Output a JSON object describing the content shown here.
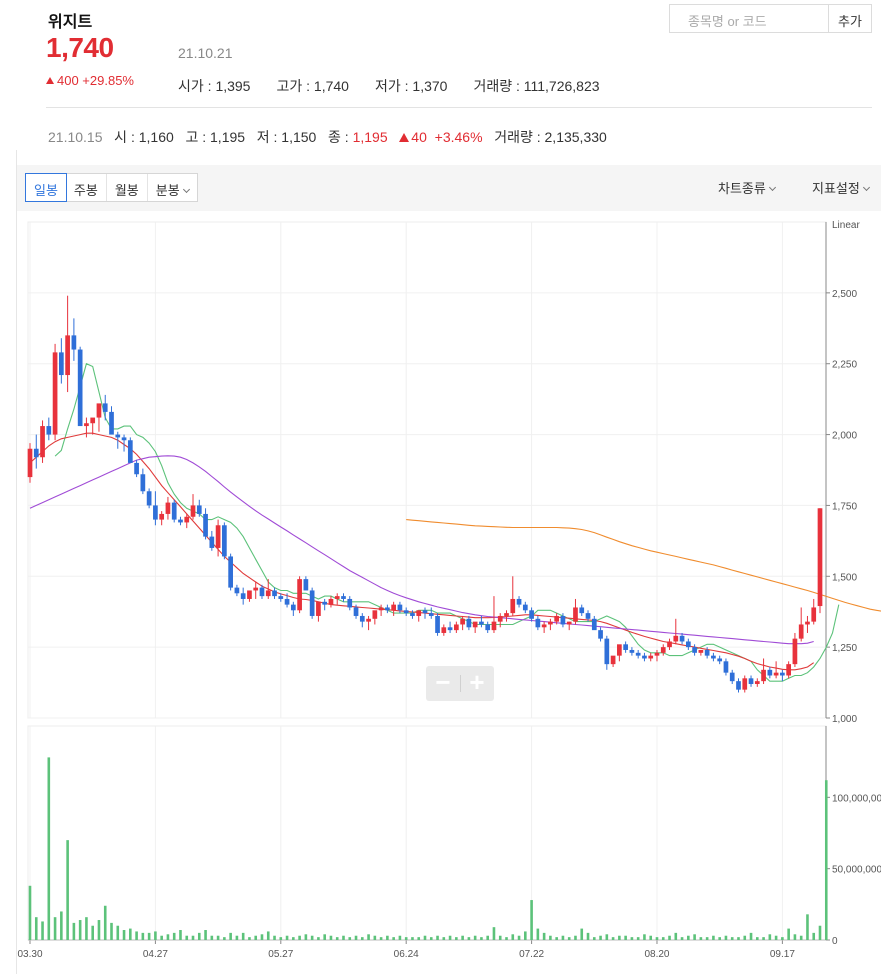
{
  "header": {
    "name": "위지트",
    "price": "1,740",
    "date": "21.10.21",
    "change": "400 +29.85%",
    "stats": [
      {
        "label": "시가",
        "value": "1,395"
      },
      {
        "label": "고가",
        "value": "1,740"
      },
      {
        "label": "저가",
        "value": "1,370"
      },
      {
        "label": "거래량",
        "value": "111,726,823"
      }
    ]
  },
  "search": {
    "placeholder": "종목명 or 코드",
    "add_label": "추가"
  },
  "previous": {
    "date": "21.10.15",
    "open_label": "시",
    "open": "1,160",
    "high_label": "고",
    "high": "1,195",
    "low_label": "저",
    "low": "1,150",
    "close_label": "종",
    "close": "1,195",
    "change": "40",
    "pct": "+3.46%",
    "volume_label": "거래량",
    "volume": "2,135,330"
  },
  "toolbar": {
    "tabs": [
      "일봉",
      "주봉",
      "월봉",
      "분봉"
    ],
    "active": "일봉",
    "chart_type_label": "차트종류",
    "indicator_label": "지표설정"
  },
  "colors": {
    "up": "#e8323c",
    "down": "#2f6fd8",
    "ma5": "#5cc27a",
    "ma20": "#e03a3a",
    "ma60": "#a04bd6",
    "ma120": "#f08c2e",
    "volume": "#5cc27a"
  },
  "chart_data": {
    "type": "candlestick",
    "scale_label": "Linear",
    "price_ylim": [
      1000,
      2750
    ],
    "price_ticks": [
      1000,
      1250,
      1500,
      1750,
      2000,
      2250,
      2500
    ],
    "volume_ylim": [
      0,
      150000000
    ],
    "volume_ticks": [
      "0",
      "50,000,000",
      "100,000,000"
    ],
    "x_ticks": [
      "03.30",
      "04.27",
      "05.27",
      "06.24",
      "07.22",
      "08.20",
      "09.17"
    ],
    "x_tick_index": [
      0,
      20,
      40,
      60,
      80,
      100,
      120
    ],
    "candles": [
      [
        1850,
        1970,
        1830,
        1950
      ],
      [
        1950,
        2000,
        1880,
        1920
      ],
      [
        1920,
        2050,
        1900,
        2030
      ],
      [
        2030,
        2060,
        1980,
        2000
      ],
      [
        2000,
        2320,
        1980,
        2290
      ],
      [
        2290,
        2340,
        2180,
        2210
      ],
      [
        2210,
        2490,
        2150,
        2350
      ],
      [
        2350,
        2410,
        2260,
        2300
      ],
      [
        2300,
        2310,
        2060,
        2030
      ],
      [
        2030,
        2060,
        1990,
        2040
      ],
      [
        2040,
        2050,
        2000,
        2060
      ],
      [
        2060,
        2080,
        2010,
        2110
      ],
      [
        2110,
        2140,
        2050,
        2080
      ],
      [
        2080,
        2100,
        2010,
        2000
      ],
      [
        2000,
        2010,
        1950,
        1990
      ],
      [
        1990,
        2000,
        1940,
        1980
      ],
      [
        1980,
        1990,
        1900,
        1900
      ],
      [
        1900,
        1910,
        1850,
        1860
      ],
      [
        1860,
        1880,
        1790,
        1800
      ],
      [
        1800,
        1810,
        1740,
        1750
      ],
      [
        1750,
        1800,
        1680,
        1700
      ],
      [
        1700,
        1730,
        1680,
        1720
      ],
      [
        1720,
        1780,
        1700,
        1760
      ],
      [
        1760,
        1770,
        1690,
        1700
      ],
      [
        1700,
        1710,
        1680,
        1690
      ],
      [
        1690,
        1720,
        1670,
        1710
      ],
      [
        1710,
        1790,
        1700,
        1750
      ],
      [
        1750,
        1770,
        1710,
        1720
      ],
      [
        1720,
        1740,
        1630,
        1640
      ],
      [
        1640,
        1660,
        1590,
        1600
      ],
      [
        1600,
        1700,
        1570,
        1680
      ],
      [
        1680,
        1690,
        1560,
        1570
      ],
      [
        1570,
        1580,
        1450,
        1460
      ],
      [
        1460,
        1470,
        1430,
        1440
      ],
      [
        1440,
        1460,
        1400,
        1420
      ],
      [
        1420,
        1440,
        1410,
        1450
      ],
      [
        1450,
        1480,
        1420,
        1460
      ],
      [
        1460,
        1470,
        1420,
        1430
      ],
      [
        1430,
        1490,
        1420,
        1450
      ],
      [
        1450,
        1460,
        1420,
        1430
      ],
      [
        1430,
        1440,
        1410,
        1420
      ],
      [
        1420,
        1440,
        1390,
        1400
      ],
      [
        1400,
        1410,
        1360,
        1380
      ],
      [
        1380,
        1500,
        1370,
        1490
      ],
      [
        1490,
        1500,
        1460,
        1450
      ],
      [
        1450,
        1460,
        1350,
        1360
      ],
      [
        1360,
        1370,
        1340,
        1410
      ],
      [
        1410,
        1420,
        1380,
        1400
      ],
      [
        1400,
        1430,
        1390,
        1420
      ],
      [
        1420,
        1440,
        1400,
        1430
      ],
      [
        1430,
        1440,
        1410,
        1420
      ],
      [
        1420,
        1430,
        1380,
        1390
      ],
      [
        1390,
        1400,
        1350,
        1360
      ],
      [
        1360,
        1370,
        1320,
        1340
      ],
      [
        1340,
        1360,
        1310,
        1350
      ],
      [
        1350,
        1370,
        1330,
        1380
      ],
      [
        1380,
        1400,
        1360,
        1390
      ],
      [
        1390,
        1400,
        1370,
        1380
      ],
      [
        1380,
        1410,
        1360,
        1400
      ],
      [
        1400,
        1410,
        1370,
        1380
      ],
      [
        1380,
        1390,
        1360,
        1370
      ],
      [
        1370,
        1380,
        1350,
        1360
      ],
      [
        1360,
        1370,
        1340,
        1380
      ],
      [
        1380,
        1390,
        1350,
        1370
      ],
      [
        1370,
        1390,
        1350,
        1360
      ],
      [
        1360,
        1370,
        1290,
        1300
      ],
      [
        1300,
        1330,
        1290,
        1320
      ],
      [
        1320,
        1340,
        1300,
        1310
      ],
      [
        1310,
        1340,
        1300,
        1330
      ],
      [
        1330,
        1360,
        1310,
        1350
      ],
      [
        1350,
        1360,
        1310,
        1320
      ],
      [
        1320,
        1330,
        1300,
        1340
      ],
      [
        1340,
        1360,
        1320,
        1330
      ],
      [
        1330,
        1340,
        1300,
        1310
      ],
      [
        1310,
        1430,
        1300,
        1340
      ],
      [
        1340,
        1370,
        1320,
        1360
      ],
      [
        1360,
        1380,
        1340,
        1370
      ],
      [
        1370,
        1500,
        1360,
        1420
      ],
      [
        1420,
        1430,
        1390,
        1400
      ],
      [
        1400,
        1410,
        1370,
        1380
      ],
      [
        1380,
        1390,
        1340,
        1350
      ],
      [
        1350,
        1360,
        1310,
        1320
      ],
      [
        1320,
        1340,
        1300,
        1330
      ],
      [
        1330,
        1350,
        1310,
        1340
      ],
      [
        1340,
        1370,
        1330,
        1360
      ],
      [
        1360,
        1370,
        1320,
        1330
      ],
      [
        1330,
        1340,
        1310,
        1340
      ],
      [
        1340,
        1420,
        1330,
        1390
      ],
      [
        1390,
        1400,
        1360,
        1370
      ],
      [
        1370,
        1380,
        1340,
        1350
      ],
      [
        1350,
        1360,
        1320,
        1310
      ],
      [
        1310,
        1320,
        1270,
        1280
      ],
      [
        1280,
        1290,
        1170,
        1190
      ],
      [
        1190,
        1210,
        1180,
        1220
      ],
      [
        1220,
        1230,
        1200,
        1260
      ],
      [
        1260,
        1270,
        1230,
        1240
      ],
      [
        1240,
        1250,
        1220,
        1230
      ],
      [
        1230,
        1240,
        1210,
        1220
      ],
      [
        1220,
        1230,
        1200,
        1210
      ],
      [
        1210,
        1230,
        1200,
        1220
      ],
      [
        1220,
        1240,
        1200,
        1230
      ],
      [
        1230,
        1260,
        1220,
        1250
      ],
      [
        1250,
        1280,
        1240,
        1270
      ],
      [
        1270,
        1350,
        1260,
        1290
      ],
      [
        1290,
        1300,
        1260,
        1270
      ],
      [
        1270,
        1280,
        1240,
        1250
      ],
      [
        1250,
        1260,
        1220,
        1230
      ],
      [
        1230,
        1240,
        1220,
        1240
      ],
      [
        1240,
        1250,
        1210,
        1220
      ],
      [
        1220,
        1230,
        1200,
        1210
      ],
      [
        1210,
        1220,
        1190,
        1200
      ],
      [
        1200,
        1210,
        1150,
        1160
      ],
      [
        1160,
        1170,
        1120,
        1130
      ],
      [
        1130,
        1140,
        1090,
        1100
      ],
      [
        1100,
        1150,
        1090,
        1140
      ],
      [
        1140,
        1150,
        1110,
        1120
      ],
      [
        1120,
        1140,
        1110,
        1130
      ],
      [
        1130,
        1210,
        1120,
        1170
      ],
      [
        1170,
        1180,
        1140,
        1150
      ],
      [
        1150,
        1200,
        1140,
        1160
      ],
      [
        1160,
        1170,
        1130,
        1150
      ],
      [
        1150,
        1200,
        1140,
        1190
      ],
      [
        1190,
        1300,
        1180,
        1280
      ],
      [
        1280,
        1390,
        1270,
        1330
      ],
      [
        1330,
        1360,
        1300,
        1340
      ],
      [
        1340,
        1420,
        1330,
        1390
      ],
      [
        1395,
        1740,
        1370,
        1740
      ]
    ],
    "ma": [
      {
        "period": 5,
        "color": "#5cc27a",
        "start": 4,
        "values": [
          1924,
          1944,
          2020,
          2090,
          2170,
          2250,
          2240,
          2150,
          2060,
          2020,
          2020,
          2030,
          2030,
          2000,
          1990,
          1970,
          1940,
          1890,
          1830,
          1790,
          1760,
          1740,
          1730,
          1720,
          1700,
          1700,
          1710,
          1700,
          1690,
          1670,
          1640,
          1600,
          1560,
          1520,
          1480,
          1460,
          1450,
          1450,
          1440,
          1440,
          1440,
          1430,
          1420,
          1430,
          1430,
          1420,
          1410,
          1410,
          1410,
          1410,
          1410,
          1400,
          1390,
          1380,
          1370,
          1370,
          1370,
          1370,
          1380,
          1380,
          1380,
          1370,
          1370,
          1370,
          1360,
          1350,
          1340,
          1330,
          1330,
          1330,
          1330,
          1330,
          1330,
          1330,
          1340,
          1350,
          1360,
          1380,
          1380,
          1380,
          1370,
          1360,
          1350,
          1340,
          1340,
          1340,
          1340,
          1350,
          1360,
          1350,
          1340,
          1320,
          1290,
          1260,
          1240,
          1230,
          1230,
          1230,
          1220,
          1220,
          1220,
          1230,
          1240,
          1250,
          1260,
          1260,
          1250,
          1240,
          1230,
          1220,
          1210,
          1200,
          1170,
          1150,
          1130,
          1130,
          1130,
          1140,
          1150,
          1150,
          1160,
          1180,
          1210,
          1250,
          1300,
          1400
        ]
      },
      {
        "period": 20,
        "color": "#e03a3a",
        "start": 0,
        "values": [
          1900,
          1920,
          1940,
          1960,
          1975,
          1985,
          1990,
          1995,
          2000,
          2005,
          2005,
          2000,
          1995,
          1990,
          1980,
          1965,
          1950,
          1930,
          1905,
          1880,
          1850,
          1820,
          1795,
          1770,
          1745,
          1720,
          1695,
          1670,
          1645,
          1620,
          1595,
          1570,
          1550,
          1530,
          1510,
          1495,
          1480,
          1465,
          1455,
          1445,
          1438,
          1432,
          1425,
          1420,
          1418,
          1415,
          1410,
          1405,
          1400,
          1398,
          1396,
          1394,
          1392,
          1390,
          1388,
          1386,
          1384,
          1382,
          1380,
          1378,
          1376,
          1374,
          1372,
          1370,
          1368,
          1366,
          1364,
          1362,
          1360,
          1358,
          1356,
          1354,
          1354,
          1354,
          1355,
          1356,
          1358,
          1360,
          1362,
          1364,
          1364,
          1362,
          1360,
          1358,
          1356,
          1354,
          1352,
          1350,
          1348,
          1346,
          1344,
          1340,
          1334,
          1326,
          1318,
          1310,
          1302,
          1295,
          1288,
          1282,
          1276,
          1270,
          1266,
          1262,
          1258,
          1254,
          1250,
          1246,
          1242,
          1238,
          1234,
          1230,
          1224,
          1218,
          1210,
          1200,
          1192,
          1186,
          1180,
          1176,
          1172,
          1170,
          1170,
          1174,
          1180,
          1195
        ]
      },
      {
        "period": 60,
        "color": "#a04bd6",
        "start": 0,
        "values": [
          1740,
          1750,
          1760,
          1770,
          1780,
          1790,
          1800,
          1810,
          1820,
          1830,
          1840,
          1850,
          1860,
          1870,
          1880,
          1890,
          1900,
          1910,
          1915,
          1920,
          1922,
          1924,
          1925,
          1924,
          1920,
          1912,
          1900,
          1886,
          1870,
          1852,
          1834,
          1815,
          1797,
          1780,
          1763,
          1747,
          1731,
          1716,
          1702,
          1688,
          1674,
          1660,
          1646,
          1632,
          1618,
          1604,
          1590,
          1576,
          1562,
          1548,
          1534,
          1520,
          1508,
          1496,
          1484,
          1472,
          1460,
          1450,
          1440,
          1432,
          1424,
          1417,
          1410,
          1404,
          1398,
          1392,
          1387,
          1382,
          1377,
          1372,
          1368,
          1364,
          1361,
          1358,
          1356,
          1354,
          1352,
          1350,
          1348,
          1346,
          1344,
          1342,
          1340,
          1338,
          1336,
          1334,
          1332,
          1330,
          1328,
          1326,
          1324,
          1322,
          1320,
          1318,
          1316,
          1314,
          1312,
          1310,
          1308,
          1306,
          1304,
          1302,
          1300,
          1298,
          1296,
          1294,
          1292,
          1290,
          1288,
          1286,
          1284,
          1282,
          1280,
          1278,
          1276,
          1274,
          1272,
          1270,
          1268,
          1266,
          1264,
          1262,
          1262,
          1262,
          1264,
          1270
        ]
      },
      {
        "period": 120,
        "color": "#f08c2e",
        "start": 60,
        "values": [
          1700,
          1698,
          1696,
          1694,
          1692,
          1690,
          1688,
          1686,
          1684,
          1682,
          1680,
          1678,
          1677,
          1676,
          1675,
          1674,
          1673,
          1672,
          1672,
          1672,
          1672,
          1672,
          1672,
          1672,
          1672,
          1671,
          1670,
          1668,
          1665,
          1660,
          1654,
          1646,
          1638,
          1630,
          1622,
          1615,
          1608,
          1602,
          1596,
          1590,
          1585,
          1580,
          1575,
          1570,
          1565,
          1560,
          1555,
          1550,
          1545,
          1540,
          1534,
          1528,
          1522,
          1516,
          1510,
          1504,
          1498,
          1492,
          1486,
          1480,
          1474,
          1468,
          1462,
          1456,
          1450,
          1443,
          1436,
          1429,
          1422,
          1415,
          1408,
          1402,
          1396,
          1390,
          1384,
          1380,
          1376,
          1372,
          1370,
          1368
        ]
      }
    ],
    "volumes": [
      38,
      16,
      13,
      128,
      16,
      20,
      70,
      12,
      14,
      16,
      10,
      14,
      24,
      12,
      10,
      7,
      8,
      6,
      5,
      5,
      6,
      3,
      4,
      5,
      7,
      3,
      3,
      5,
      7,
      3,
      3,
      2,
      5,
      3,
      5,
      2,
      3,
      4,
      6,
      3,
      2,
      3,
      2,
      3,
      4,
      3,
      2,
      4,
      3,
      2,
      3,
      2,
      3,
      2,
      4,
      3,
      2,
      3,
      2,
      3,
      2,
      2,
      2,
      3,
      2,
      3,
      2,
      3,
      2,
      3,
      2,
      3,
      2,
      3,
      9,
      3,
      2,
      4,
      3,
      6,
      28,
      8,
      5,
      3,
      2,
      3,
      2,
      3,
      8,
      5,
      2,
      3,
      4,
      2,
      3,
      3,
      2,
      2,
      4,
      3,
      2,
      2,
      3,
      5,
      2,
      3,
      4,
      2,
      2,
      3,
      2,
      3,
      2,
      2,
      3,
      5,
      2,
      2,
      4,
      3,
      2,
      8,
      4,
      3,
      18,
      5,
      10,
      112
    ]
  }
}
